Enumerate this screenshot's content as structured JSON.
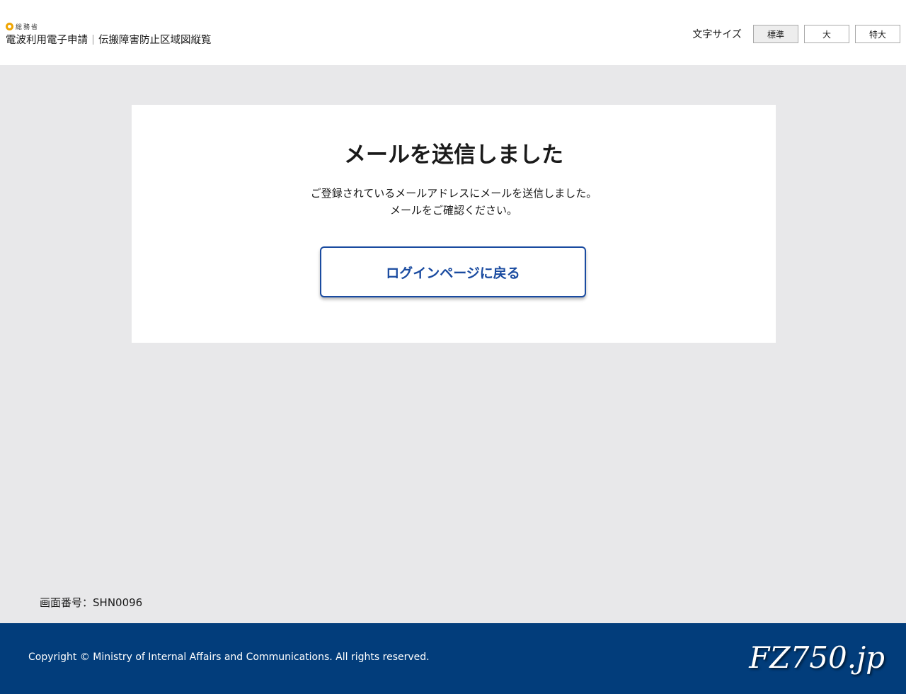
{
  "header": {
    "ministry": "総務省",
    "system_name": "電波利用電子申請",
    "sub_system": "伝搬障害防止区域図縦覧",
    "font_size": {
      "label": "文字サイズ",
      "options": [
        "標準",
        "大",
        "特大"
      ],
      "selected": "標準"
    }
  },
  "main": {
    "title": "メールを送信しました",
    "message_line1": "ご登録されているメールアドレスにメールを送信しました。",
    "message_line2": "メールをご確認ください。",
    "back_button": "ログインページに戻る"
  },
  "screen_id": {
    "label": "画面番号：",
    "value": "SHN0096"
  },
  "footer": {
    "copyright": "Copyright © Ministry of Internal Affairs and Communications. All rights reserved.",
    "watermark": "FZ750.jp"
  },
  "colors": {
    "brand_blue": "#1a4ba0",
    "footer_bg": "#023d7b",
    "page_bg": "#e8e8ea",
    "ministry_accent": "#f0a500"
  }
}
